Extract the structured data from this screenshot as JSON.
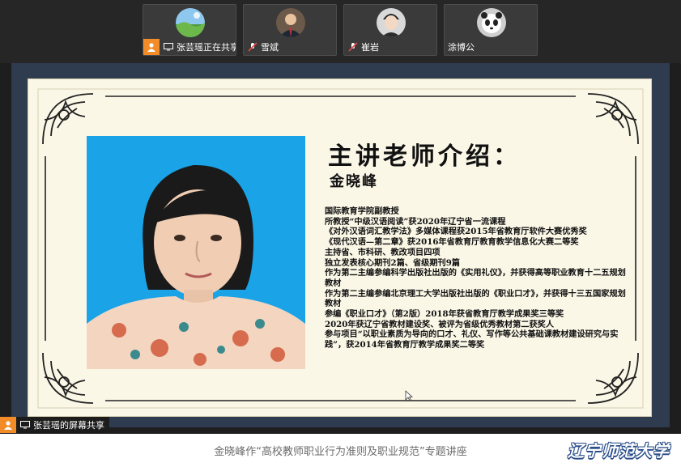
{
  "participants": [
    {
      "name": "张芸瑶正在共享",
      "role": "host-sharing",
      "avatar": "landscape-avatar"
    },
    {
      "name": "雪斌",
      "role": "attendee",
      "avatar": "man-suit-avatar"
    },
    {
      "name": "崔岩",
      "role": "attendee",
      "avatar": "cartoon-man-avatar"
    },
    {
      "name": "涂博公",
      "role": "attendee",
      "avatar": "panda-avatar"
    }
  ],
  "slide": {
    "title": "主讲老师介绍：",
    "speaker_name": "金晓峰",
    "bio_lines": [
      "国际教育学院副教授",
      "所教授“中级汉语阅读”获2020年辽宁省一流课程",
      "《对外汉语词汇教学法》多媒体课程获2015年省教育厅软件大赛优秀奖",
      "《现代汉语—第二章》获2016年省教育厅教育教学信息化大赛二等奖",
      "主持省、市科研、教改项目四项",
      "独立发表核心期刊2篇、省级期刊9篇",
      "作为第二主编参编科学出版社出版的《实用礼仪》，并获得高等职业教育十二五规划教材",
      "作为第二主编参编北京理工大学出版社出版的《职业口才》，并获得十三五国家规划教材",
      "参编《职业口才》（第2版）2018年获省教育厅教学成果奖三等奖",
      "2020年获辽宁省教材建设奖、被评为省级优秀教材第二获奖人",
      "参与项目“以职业素质为导向的口才、礼仪、写作等公共基础课教材建设研究与实践”，获2014年省教育厅教学成果奖二等奖"
    ]
  },
  "share_badge": {
    "label": "张芸瑶的屏幕共享"
  },
  "caption": {
    "text": "金晓峰作“高校教师职业行为准则及职业规范”专题讲座",
    "logo": "辽宁师范大学"
  },
  "colors": {
    "topbar": "#262626",
    "host_orange": "#f28c28",
    "slide_bg": "#fbf7e7",
    "photo_bg": "#1aa3e6",
    "logo_blue": "#2a4e8a"
  }
}
